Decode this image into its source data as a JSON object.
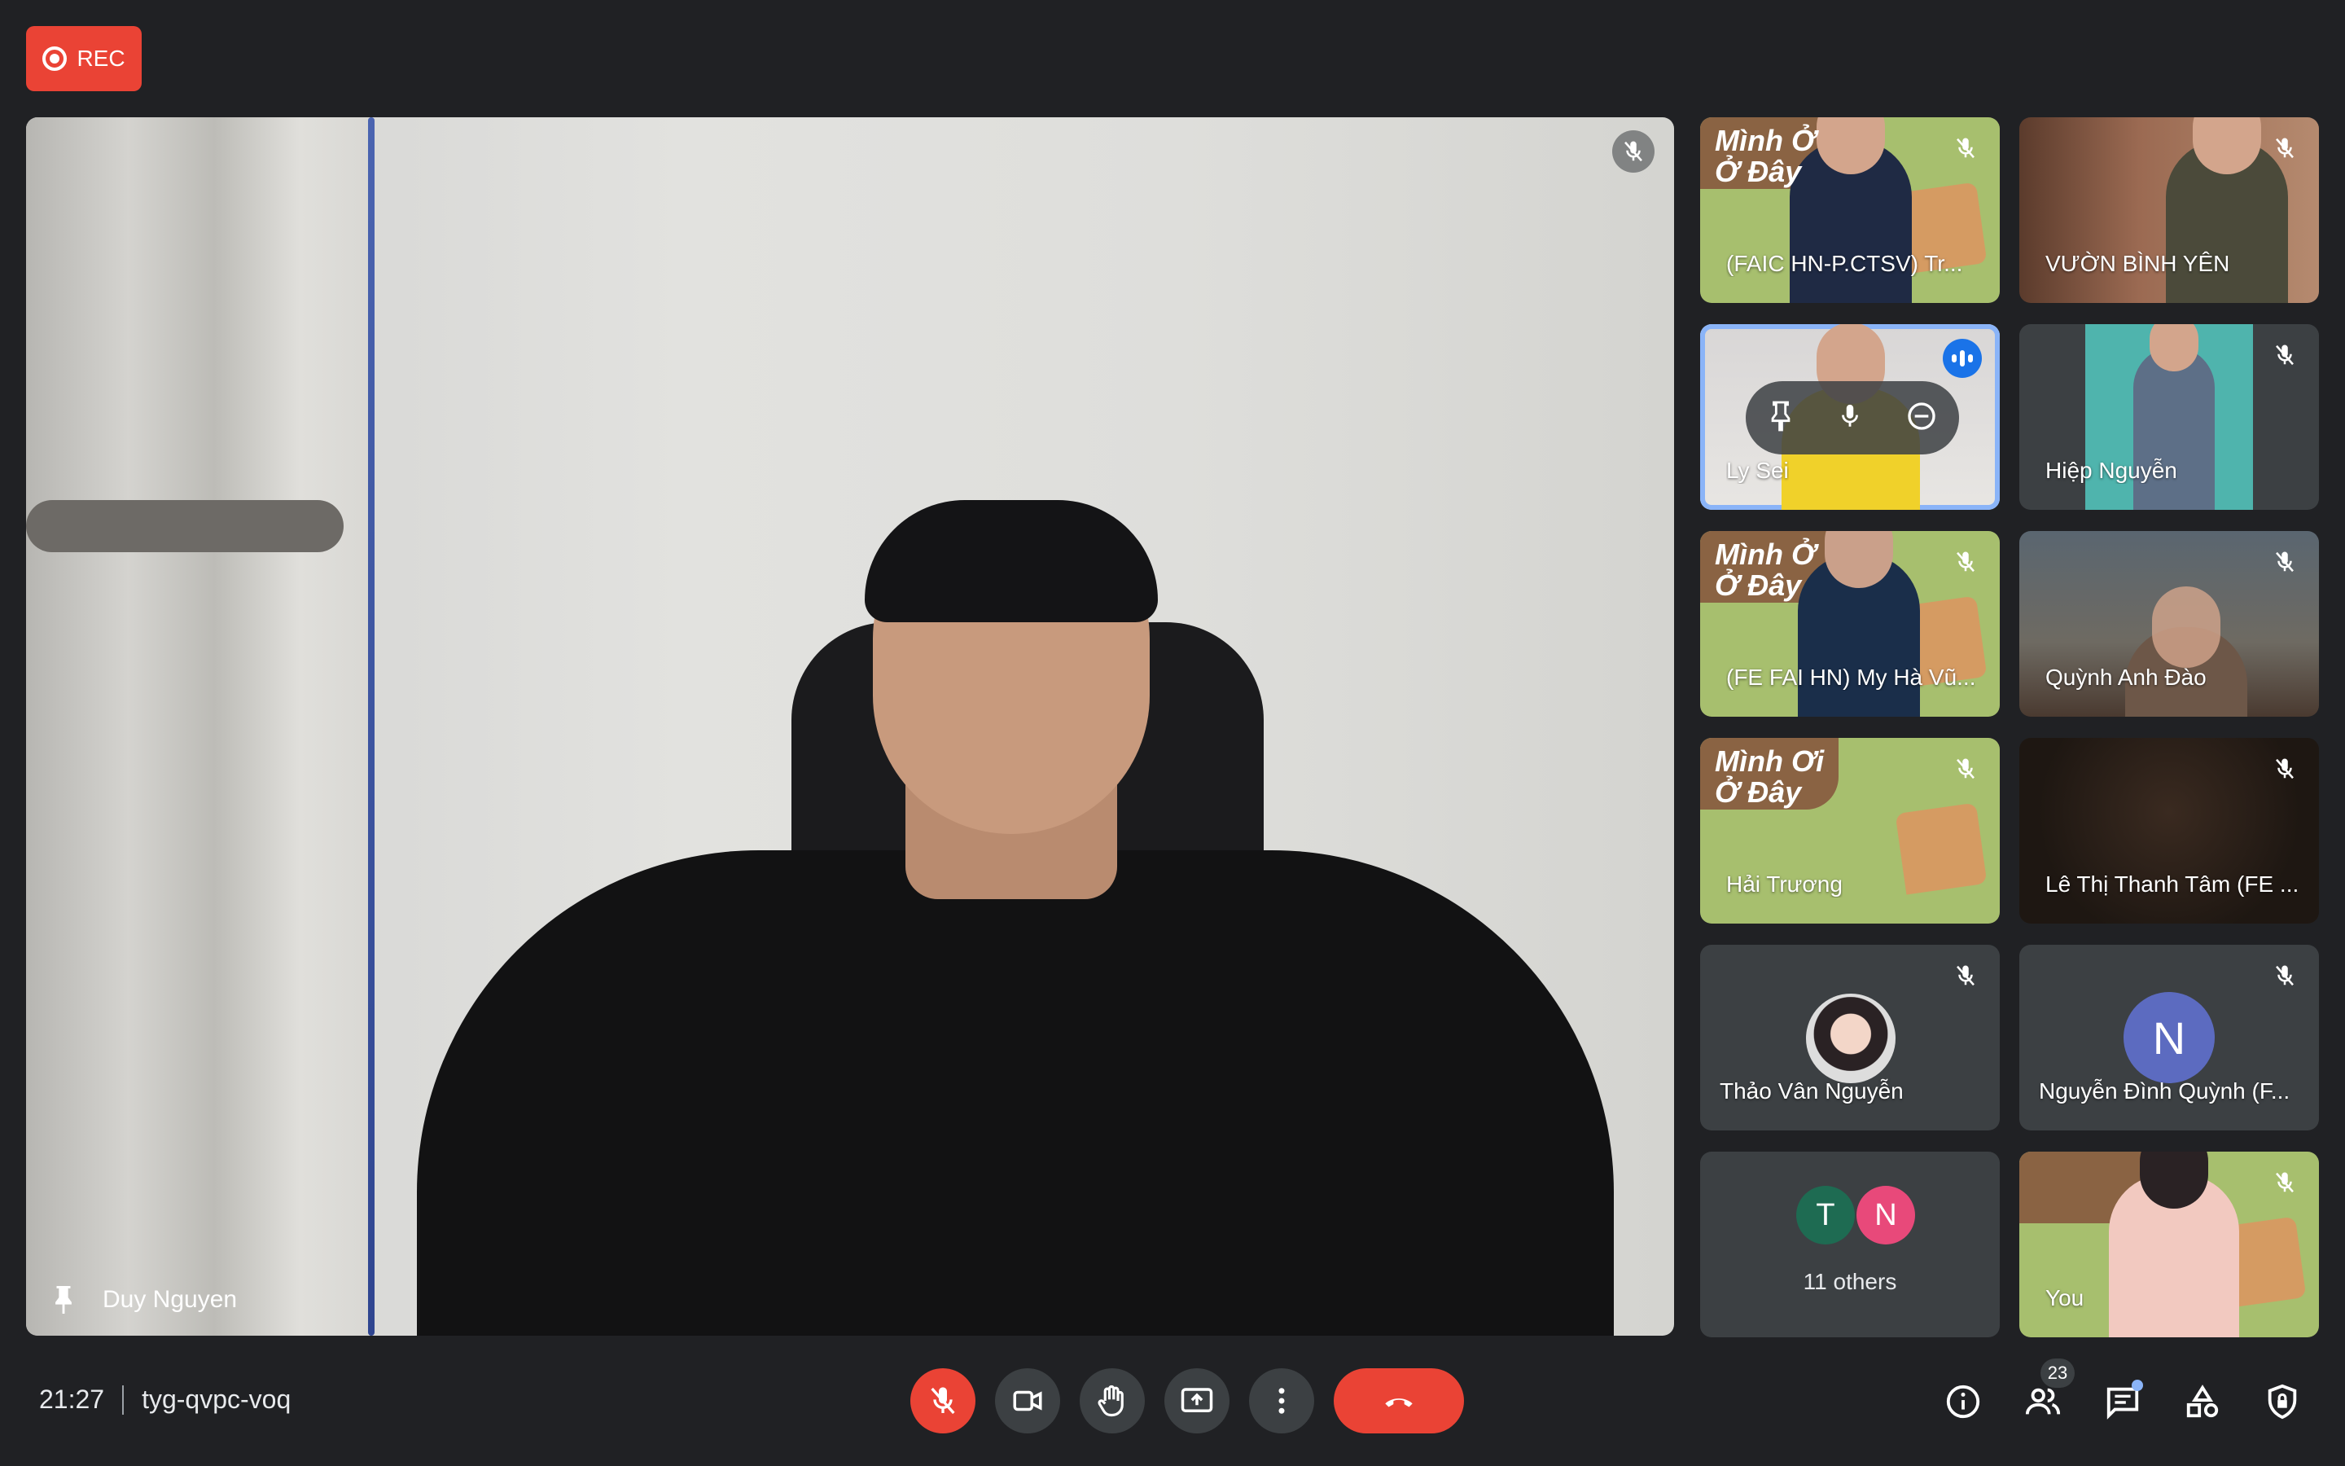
{
  "rec": {
    "label": "REC"
  },
  "main": {
    "participant_name": "Duy Nguyen"
  },
  "tiles": [
    {
      "name": "(FAIC HN-P.CTSV) Tr...",
      "banner": "Mình Ở\nỞ Đây"
    },
    {
      "name": "VƯỜN BÌNH YÊN"
    },
    {
      "name": "Ly Sei"
    },
    {
      "name": "Hiệp Nguyễn"
    },
    {
      "name": "(FE FAI HN) My Hà Vũ...",
      "banner": "Mình Ở\nỞ Đây"
    },
    {
      "name": "Quỳnh Anh Đào"
    },
    {
      "name": "Hải Trương",
      "banner": "Mình Ơi\nỞ Đây"
    },
    {
      "name": "Lê Thị Thanh Tâm (FE ..."
    },
    {
      "name": "Thảo Vân Nguyễn"
    },
    {
      "name": "Nguyễn Đình Quỳnh (F...",
      "avatar_letter": "N"
    },
    {
      "name": "11 others",
      "avatars": [
        "T",
        "N"
      ]
    },
    {
      "name": "You"
    }
  ],
  "bottom": {
    "time": "21:27",
    "meeting_code": "tyg-qvpc-voq",
    "people_count": "23"
  },
  "colors": {
    "rec": "#ea4335",
    "speaking": "#1a73e8",
    "avatar_n": "#5c6bc0",
    "avatar_t": "#1e6b52",
    "avatar_pink": "#e8497a"
  }
}
